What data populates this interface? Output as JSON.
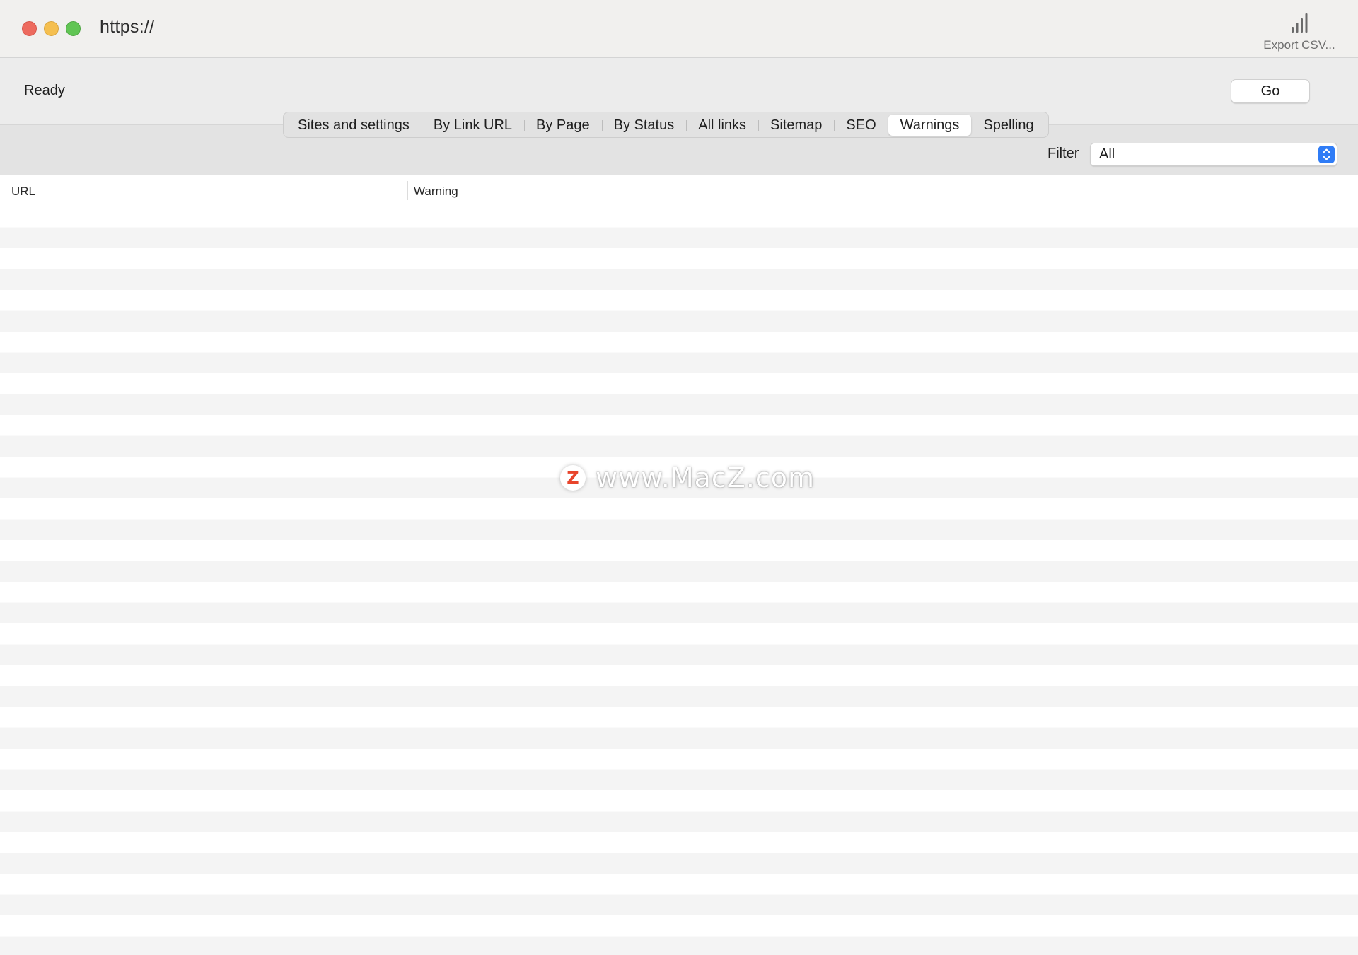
{
  "window": {
    "url_field": "https://",
    "export_label": "Export CSV..."
  },
  "toolbar": {
    "status": "Ready",
    "go_label": "Go"
  },
  "tabs": [
    {
      "label": "Sites and settings",
      "active": false
    },
    {
      "label": "By Link URL",
      "active": false
    },
    {
      "label": "By Page",
      "active": false
    },
    {
      "label": "By Status",
      "active": false
    },
    {
      "label": "All links",
      "active": false
    },
    {
      "label": "Sitemap",
      "active": false
    },
    {
      "label": "SEO",
      "active": false
    },
    {
      "label": "Warnings",
      "active": true
    },
    {
      "label": "Spelling",
      "active": false
    }
  ],
  "filter": {
    "label": "Filter",
    "selected": "All"
  },
  "table": {
    "columns": [
      "URL",
      "Warning"
    ],
    "rows": []
  },
  "watermark": {
    "logo_letter": "Z",
    "text": "www.MacZ.com"
  },
  "colors": {
    "accent": "#2f7cf6",
    "close": "#ed6a5e",
    "minimize": "#f5bf4f",
    "maximize": "#61c554",
    "watermark_logo": "#e8452c"
  },
  "icons": {
    "export": "bar-chart-icon",
    "select": "chevron-up-down-icon"
  }
}
